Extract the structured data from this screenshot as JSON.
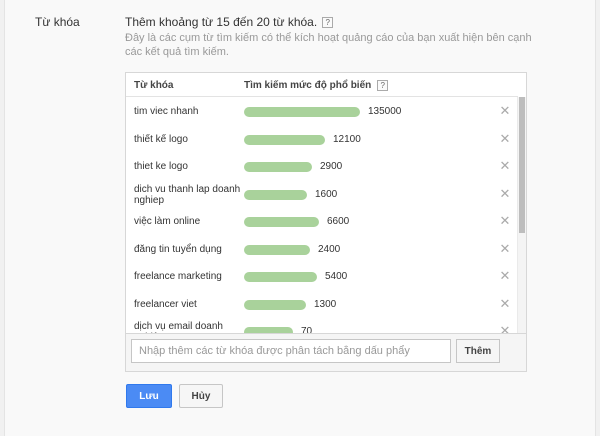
{
  "section_label": "Từ khóa",
  "heading": "Thêm khoảng từ 15 đến 20 từ khóa.",
  "help_glyph": "?",
  "description": "Đây là các cụm từ tìm kiếm có thể kích hoạt quảng cáo của bạn xuất hiện bên cạnh các kết quả tìm kiếm.",
  "table": {
    "col_keyword": "Từ khóa",
    "col_popularity": "Tìm kiếm mức độ phổ biến",
    "max_value": 135000,
    "rows": [
      {
        "keyword": "tim viec nhanh",
        "value": "135000"
      },
      {
        "keyword": "thiết kế logo",
        "value": "12100"
      },
      {
        "keyword": "thiet ke logo",
        "value": "2900"
      },
      {
        "keyword": "dich vu thanh lap doanh nghiep",
        "value": "1600"
      },
      {
        "keyword": "việc làm online",
        "value": "6600"
      },
      {
        "keyword": "đăng tin tuyển dụng",
        "value": "2400"
      },
      {
        "keyword": "freelance marketing",
        "value": "5400"
      },
      {
        "keyword": "freelancer viet",
        "value": "1300"
      },
      {
        "keyword": "dịch vụ email doanh nghiệp",
        "value": "70"
      }
    ],
    "delete_glyph": "✕",
    "bar_color": "#a9d29b"
  },
  "add": {
    "placeholder": "Nhập thêm các từ khóa được phân tách bằng dấu phẩy",
    "value": "",
    "button": "Thêm"
  },
  "actions": {
    "save": "Lưu",
    "cancel": "Hủy"
  },
  "colors": {
    "primary": "#4b8bf4"
  }
}
